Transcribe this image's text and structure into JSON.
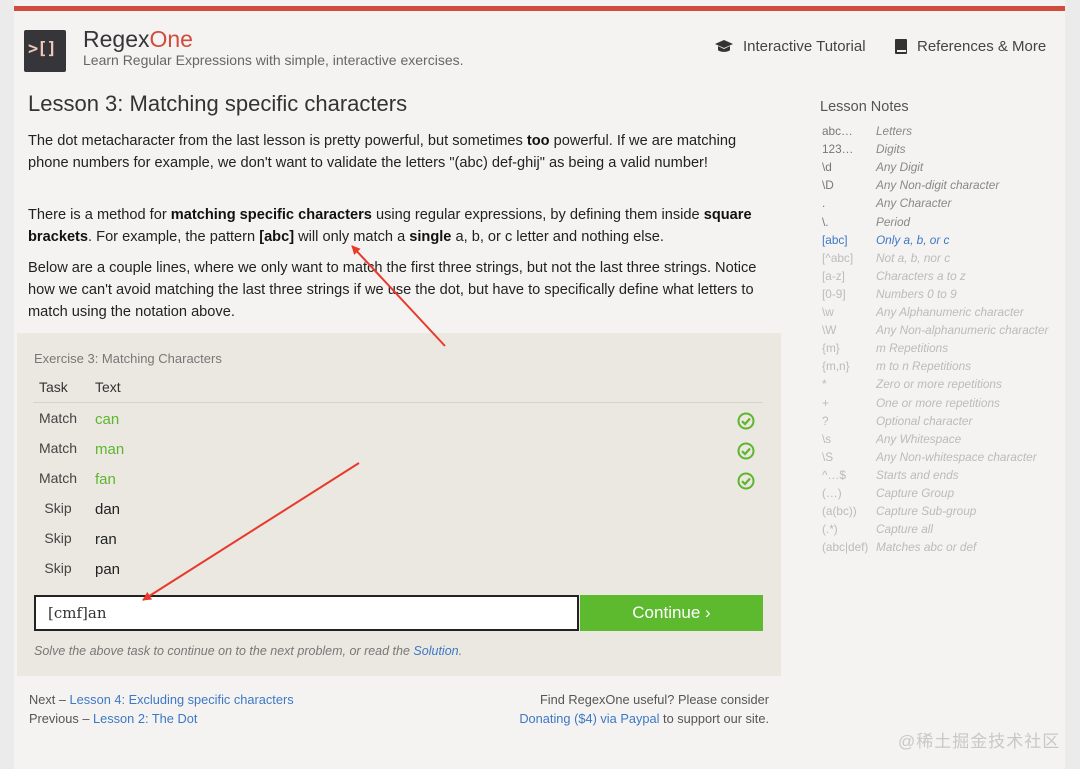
{
  "brand": {
    "logo_text": ">[]",
    "name_main": "Regex",
    "name_accent": "One",
    "tagline": "Learn Regular Expressions with simple, interactive exercises."
  },
  "nav": {
    "tutorial": "Interactive Tutorial",
    "references": "References & More"
  },
  "lesson": {
    "title": "Lesson 3: Matching specific characters",
    "p1_a": "The dot metacharacter from the last lesson is pretty powerful, but sometimes ",
    "p1_b": "too",
    "p1_c": " powerful. If we are matching phone numbers for example, we don't want to validate the letters \"(abc) def-ghij\" as being a valid number!",
    "p2_a": "There is a method for ",
    "p2_b": "matching specific characters",
    "p2_c": " using regular expressions, by defining them inside ",
    "p2_d": "square brackets",
    "p2_e": ". For example, the pattern ",
    "p2_f": "[abc]",
    "p2_g": " will only match a ",
    "p2_h": "single",
    "p2_i": " a, b, or c letter and nothing else.",
    "p3": "Below are a couple lines, where we only want to match the first three strings, but not the last three strings. Notice how we can't avoid matching the last three strings if we use the dot, but have to specifically define what letters to match using the notation above."
  },
  "exercise": {
    "title": "Exercise 3: Matching Characters",
    "col_task": "Task",
    "col_text": "Text",
    "rows": [
      {
        "task": "Match",
        "text": "can",
        "passed": true
      },
      {
        "task": "Match",
        "text": "man",
        "passed": true
      },
      {
        "task": "Match",
        "text": "fan",
        "passed": true
      },
      {
        "task": "Skip",
        "text": "dan",
        "passed": false
      },
      {
        "task": "Skip",
        "text": "ran",
        "passed": false
      },
      {
        "task": "Skip",
        "text": "pan",
        "passed": false
      }
    ],
    "input_value": "[cmf]an",
    "continue_label": "Continue ›",
    "hint_prefix": "Solve the above task to continue on to the next problem, or read the ",
    "hint_link": "Solution",
    "hint_suffix": "."
  },
  "footer": {
    "next_label": "Next – ",
    "next_link": "Lesson 4: Excluding specific characters",
    "prev_label": "Previous – ",
    "prev_link": "Lesson 2: The Dot",
    "donate_text": "Find RegexOne useful? Please consider",
    "donate_link": "Donating ($4) via Paypal",
    "donate_suffix": " to support our site."
  },
  "notes": {
    "title": "Lesson Notes",
    "items": [
      {
        "k": "abc…",
        "v": "Letters",
        "style": "dark"
      },
      {
        "k": "123…",
        "v": "Digits",
        "style": "dark"
      },
      {
        "k": "\\d",
        "v": "Any Digit",
        "style": "dark"
      },
      {
        "k": "\\D",
        "v": "Any Non-digit character",
        "style": "dark"
      },
      {
        "k": ".",
        "v": "Any Character",
        "style": "dark"
      },
      {
        "k": "\\.",
        "v": "Period",
        "style": "dark"
      },
      {
        "k": "[abc]",
        "v": "Only a, b, or c",
        "style": "active"
      },
      {
        "k": "[^abc]",
        "v": "Not a, b, nor c",
        "style": "light"
      },
      {
        "k": "[a-z]",
        "v": "Characters a to z",
        "style": "light"
      },
      {
        "k": "[0-9]",
        "v": "Numbers 0 to 9",
        "style": "light"
      },
      {
        "k": "\\w",
        "v": "Any Alphanumeric character",
        "style": "light"
      },
      {
        "k": "\\W",
        "v": "Any Non-alphanumeric character",
        "style": "light"
      },
      {
        "k": "{m}",
        "v": "m Repetitions",
        "style": "light"
      },
      {
        "k": "{m,n}",
        "v": "m to n Repetitions",
        "style": "light"
      },
      {
        "k": "*",
        "v": "Zero or more repetitions",
        "style": "light"
      },
      {
        "k": "+",
        "v": "One or more repetitions",
        "style": "light"
      },
      {
        "k": "?",
        "v": "Optional character",
        "style": "light"
      },
      {
        "k": "\\s",
        "v": "Any Whitespace",
        "style": "light"
      },
      {
        "k": "\\S",
        "v": "Any Non-whitespace character",
        "style": "light"
      },
      {
        "k": "^…$",
        "v": "Starts and ends",
        "style": "light"
      },
      {
        "k": "(…)",
        "v": "Capture Group",
        "style": "light"
      },
      {
        "k": "(a(bc))",
        "v": "Capture Sub-group",
        "style": "light"
      },
      {
        "k": "(.*)",
        "v": "Capture all",
        "style": "light"
      },
      {
        "k": "(abc|def)",
        "v": "Matches abc or def",
        "style": "light"
      }
    ]
  },
  "watermark": "@稀土掘金技术社区",
  "colors": {
    "brand_red": "#d14c3c",
    "success_green": "#5dba2e",
    "link_blue": "#3d78c5",
    "annotation_arrow": "#e8392b"
  },
  "icons": {
    "tutorial": "graduation-cap-icon",
    "references": "book-icon",
    "passed": "check-circle-icon"
  }
}
